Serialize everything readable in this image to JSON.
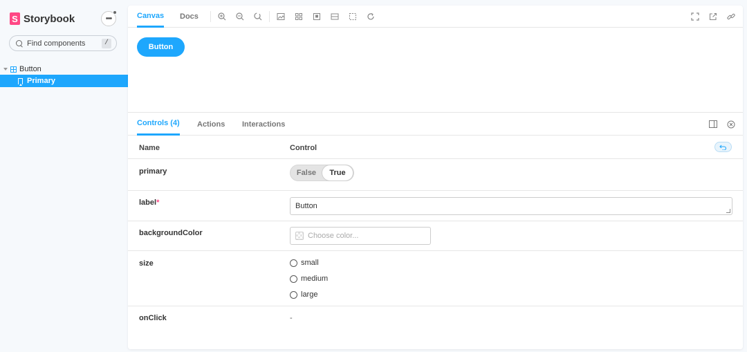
{
  "sidebar": {
    "brand_letter": "S",
    "brand_name": "Storybook",
    "menu_icon": "ellipsis-icon",
    "search": {
      "placeholder": "Find components",
      "shortcut": "/"
    },
    "tree": {
      "group_label": "Button",
      "items": [
        {
          "label": "Primary",
          "selected": true
        }
      ]
    }
  },
  "toolbar": {
    "tabs": [
      {
        "label": "Canvas",
        "active": true
      },
      {
        "label": "Docs",
        "active": false
      }
    ],
    "icons": [
      "zoom-in-icon",
      "zoom-out-icon",
      "zoom-reset-icon",
      "background-icon",
      "grid-icon",
      "viewport-icon",
      "measure-icon",
      "outline-icon",
      "remount-icon",
      "fullscreen-icon",
      "open-new-tab-icon",
      "copy-link-icon"
    ]
  },
  "canvas": {
    "button_label": "Button",
    "button_color": "#1ea7fd"
  },
  "addons": {
    "tabs": [
      {
        "label": "Controls (4)",
        "active": true
      },
      {
        "label": "Actions",
        "active": false
      },
      {
        "label": "Interactions",
        "active": false
      }
    ],
    "header": {
      "name": "Name",
      "control": "Control"
    },
    "rows": {
      "primary": {
        "name": "primary",
        "false_label": "False",
        "true_label": "True",
        "value": true
      },
      "label": {
        "name": "label",
        "required_mark": "*",
        "value": "Button"
      },
      "backgroundColor": {
        "name": "backgroundColor",
        "placeholder": "Choose color..."
      },
      "size": {
        "name": "size",
        "options": [
          "small",
          "medium",
          "large"
        ]
      },
      "onClick": {
        "name": "onClick",
        "value": "-"
      }
    }
  },
  "colors": {
    "accent": "#1ea7fd",
    "brand": "#ff4785"
  }
}
